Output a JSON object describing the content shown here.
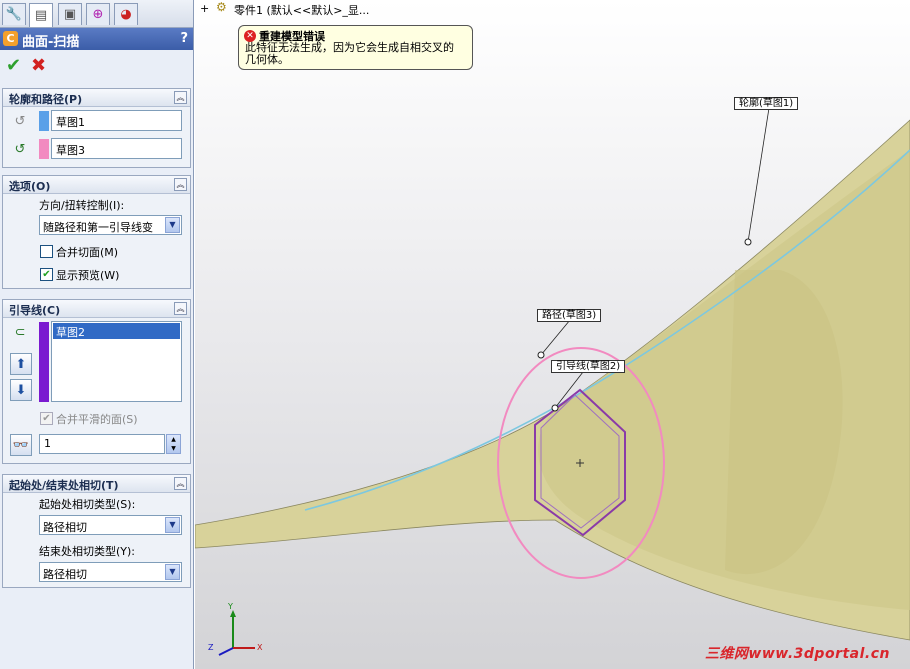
{
  "property_manager": {
    "tabs": [
      {
        "icon": "feature-manager-icon"
      },
      {
        "icon": "property-manager-icon"
      },
      {
        "icon": "configuration-manager-icon"
      },
      {
        "icon": "dimxpert-icon"
      },
      {
        "icon": "display-manager-icon"
      }
    ],
    "title": "曲面-扫描",
    "help": "?",
    "ok_glyph": "✔",
    "cancel_glyph": "✖",
    "profile_path": {
      "header": "轮廓和路径(P)",
      "profile_value": "草图1",
      "path_value": "草图3",
      "profile_color": "#5aa0e8",
      "path_color": "#f28ac0"
    },
    "options": {
      "header": "选项(O)",
      "orientation_label": "方向/扭转控制(I):",
      "orientation_value": "随路径和第一引导线变",
      "merge_tangent_label": "合并切面(M)",
      "merge_tangent_checked": false,
      "show_preview_label": "显示预览(W)",
      "show_preview_checked": true
    },
    "guide_curves": {
      "header": "引导线(C)",
      "items": [
        "草图2"
      ],
      "list_color": "#7a1ad0",
      "merge_smooth_label": "合并平滑的面(S)",
      "merge_smooth_checked": true,
      "spin_value": "1"
    },
    "tangency": {
      "header": "起始处/结束处相切(T)",
      "start_label": "起始处相切类型(S):",
      "start_value": "路径相切",
      "end_label": "结束处相切类型(Y):",
      "end_value": "路径相切"
    }
  },
  "viewport": {
    "tree_expand": "+",
    "tree_text": "零件1  (默认<<默认>_显...",
    "error_tip": {
      "title": "重建模型错误",
      "message": "此特征无法生成，因为它会生成自相交叉的几何体。"
    },
    "callouts": {
      "profile": "轮廓(草图1)",
      "path": "路径(草图3)",
      "guide": "引导线(草图2)"
    },
    "axis_labels": {
      "y": "Y",
      "x": "X",
      "z": "Z"
    },
    "watermark": "三维网www.3dportal.cn",
    "surface_color": "#d8d29a",
    "path_circle_color": "#f28ac0",
    "guide_color": "#8a3aa8"
  }
}
